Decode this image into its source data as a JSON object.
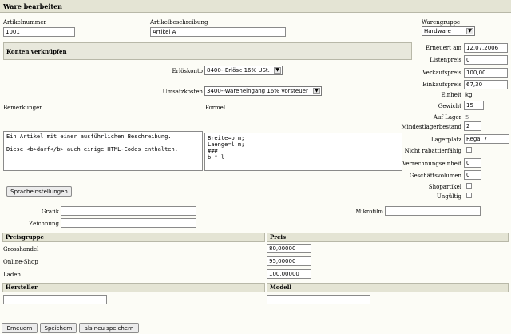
{
  "header": {
    "title": "Ware bearbeiten"
  },
  "fields": {
    "artikelnummer_label": "Artikelnummer",
    "artikelnummer_value": "1001",
    "artikelbeschreibung_label": "Artikelbeschreibung",
    "artikelbeschreibung_value": "Artikel A",
    "warengruppe_label": "Warengruppe",
    "warengruppe_value": "Hardware"
  },
  "konten": {
    "title": "Konten verknüpfen",
    "erloeskonto_label": "Erlöskonto",
    "erloeskonto_value": "8400--Erlöse 16% USt.",
    "umsatzkosten_label": "Umsatzkosten",
    "umsatzkosten_value": "3400--Wareneingang 16% Vorsteuer"
  },
  "details": {
    "erneuert_label": "Erneuert am",
    "erneuert_value": "12.07.2006",
    "listenpreis_label": "Listenpreis",
    "listenpreis_value": "0",
    "verkaufspreis_label": "Verkaufspreis",
    "verkaufspreis_value": "100,00",
    "einkaufspreis_label": "Einkaufspreis",
    "einkaufspreis_value": "67,30",
    "einheit_label": "Einheit",
    "einheit_value": "kg",
    "gewicht_label": "Gewicht",
    "gewicht_value": "15",
    "auf_lager_label": "Auf Lager",
    "auf_lager_value": "5",
    "mindestlager_label": "Mindestlagerbestand",
    "mindestlager_value": "2",
    "lagerplatz_label": "Lagerplatz",
    "lagerplatz_value": "Regal 7",
    "rabatt_label": "Nicht rabattierfähig",
    "verrechnung_label": "Verrechnungseinheit",
    "verrechnung_value": "0",
    "geschaeftsvolumen_label": "Geschäftsvolumen",
    "geschaeftsvolumen_value": "0",
    "shopartikel_label": "Shopartikel",
    "ungueltig_label": "Ungültig"
  },
  "texts": {
    "bemerkungen_label": "Bemerkungen",
    "bemerkungen_value": "Ein Artikel mit einer ausführlichen Beschreibung.\n\nDiese <b>darf</b> auch einige HTML-Codes enthalten.",
    "formel_label": "Formel",
    "formel_value": "Breite=b m;\nLaenge=l m;\n###\nb * l"
  },
  "buttons": {
    "spracheinstellungen": "Spracheinstellungen",
    "erneuern": "Erneuern",
    "speichern": "Speichern",
    "als_neu_speichern": "als neu speichern"
  },
  "media": {
    "grafik_label": "Grafik",
    "zeichnung_label": "Zeichnung",
    "mikrofilm_label": "Mikrofilm"
  },
  "preise": {
    "gruppe_header": "Preisgruppe",
    "preis_header": "Preis",
    "rows": [
      {
        "gruppe": "Grosshandel",
        "preis": "80,00000"
      },
      {
        "gruppe": "Online-Shop",
        "preis": "95,00000"
      },
      {
        "gruppe": "Laden",
        "preis": "100,00000"
      }
    ]
  },
  "hersteller": {
    "hersteller_header": "Hersteller",
    "modell_header": "Modell"
  }
}
